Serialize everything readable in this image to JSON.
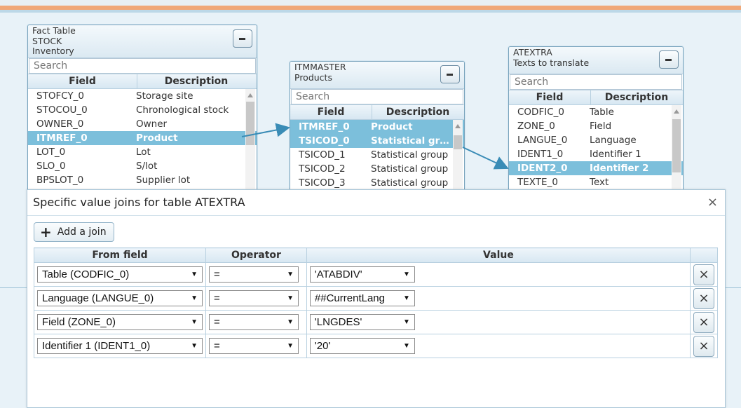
{
  "cards": [
    {
      "title_lines": [
        "Fact Table",
        "STOCK",
        "Inventory"
      ],
      "search_placeholder": "Search",
      "col_field": "Field",
      "col_desc": "Description",
      "rows": [
        {
          "field": "STOFCY_0",
          "desc": "Storage site"
        },
        {
          "field": "STOCOU_0",
          "desc": "Chronological stock"
        },
        {
          "field": "OWNER_0",
          "desc": "Owner"
        },
        {
          "field": "ITMREF_0",
          "desc": "Product",
          "selected": true
        },
        {
          "field": "LOT_0",
          "desc": "Lot"
        },
        {
          "field": "SLO_0",
          "desc": "S/lot"
        },
        {
          "field": "BPSLOT_0",
          "desc": "Supplier lot"
        }
      ]
    },
    {
      "title_lines": [
        "ITMMASTER",
        "Products"
      ],
      "search_placeholder": "Search",
      "col_field": "Field",
      "col_desc": "Description",
      "rows": [
        {
          "field": "ITMREF_0",
          "desc": "Product",
          "selected": true
        },
        {
          "field": "TSICOD_0",
          "desc": "Statistical group",
          "selected": true
        },
        {
          "field": "TSICOD_1",
          "desc": "Statistical group"
        },
        {
          "field": "TSICOD_2",
          "desc": "Statistical group"
        },
        {
          "field": "TSICOD_3",
          "desc": "Statistical group"
        }
      ]
    },
    {
      "title_lines": [
        "ATEXTRA",
        "Texts to translate"
      ],
      "search_placeholder": "Search",
      "col_field": "Field",
      "col_desc": "Description",
      "rows": [
        {
          "field": "CODFIC_0",
          "desc": "Table"
        },
        {
          "field": "ZONE_0",
          "desc": "Field"
        },
        {
          "field": "LANGUE_0",
          "desc": "Language"
        },
        {
          "field": "IDENT1_0",
          "desc": "Identifier 1"
        },
        {
          "field": "IDENT2_0",
          "desc": "Identifier 2",
          "selected": true
        },
        {
          "field": "TEXTE_0",
          "desc": "Text"
        }
      ]
    }
  ],
  "dialog": {
    "title": "Specific value joins for table ATEXTRA",
    "close_label": "×",
    "add_label": "Add a join",
    "headers": {
      "from": "From field",
      "operator": "Operator",
      "value": "Value"
    },
    "joins": [
      {
        "from": "Table (CODFIC_0)",
        "operator": "=",
        "value": "'ATABDIV'"
      },
      {
        "from": "Language (LANGUE_0)",
        "operator": "=",
        "value": "##CurrentLang"
      },
      {
        "from": "Field (ZONE_0)",
        "operator": "=",
        "value": "'LNGDES'"
      },
      {
        "from": "Identifier 1 (IDENT1_0)",
        "operator": "=",
        "value": "'20'"
      }
    ],
    "remove_label": "×"
  },
  "colors": {
    "selected_row": "#7cbfdb",
    "link_line": "#3a8cb6",
    "accent_bar": "#f0a878"
  },
  "icons": {
    "minimize": "minimize-icon",
    "close": "close-icon",
    "add": "plus-icon",
    "dropdown": "chevron-down-icon",
    "remove": "remove-icon"
  }
}
